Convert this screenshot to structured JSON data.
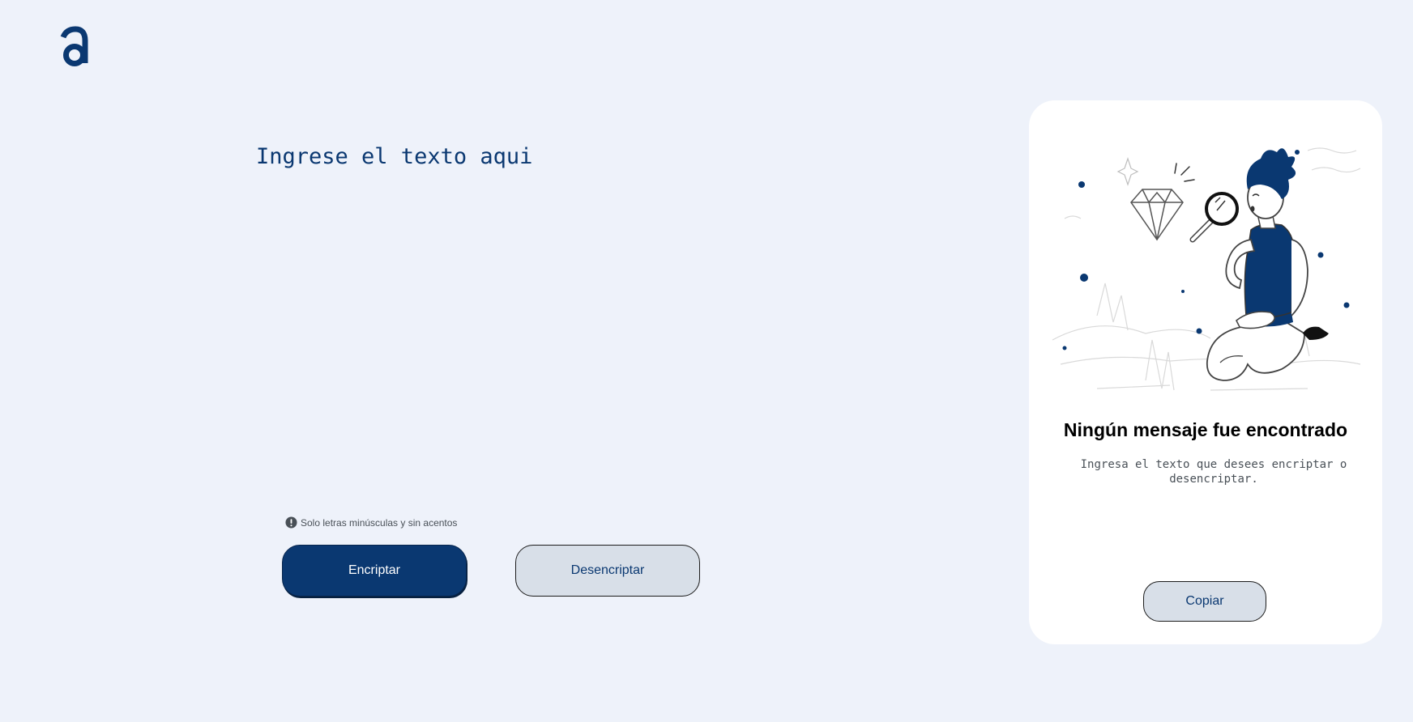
{
  "colors": {
    "background": "#eef2fa",
    "primary": "#0a3871",
    "secondary_button": "#d8dfe8",
    "panel": "#ffffff",
    "hint_text": "#495057"
  },
  "header": {
    "logo_icon": "alura-a-logo-icon"
  },
  "input": {
    "placeholder": "Ingrese el texto aqui",
    "value": ""
  },
  "hint": {
    "icon": "exclamation-circle-icon",
    "text": "Solo letras minúsculas y sin acentos"
  },
  "buttons": {
    "encrypt_label": "Encriptar",
    "decrypt_label": "Desencriptar"
  },
  "output_panel": {
    "illustration": "person-with-magnifying-glass-illustration",
    "title": "Ningún mensaje fue encontrado",
    "text": "Ingresa el texto que desees encriptar o desencriptar.",
    "copy_label": "Copiar"
  }
}
